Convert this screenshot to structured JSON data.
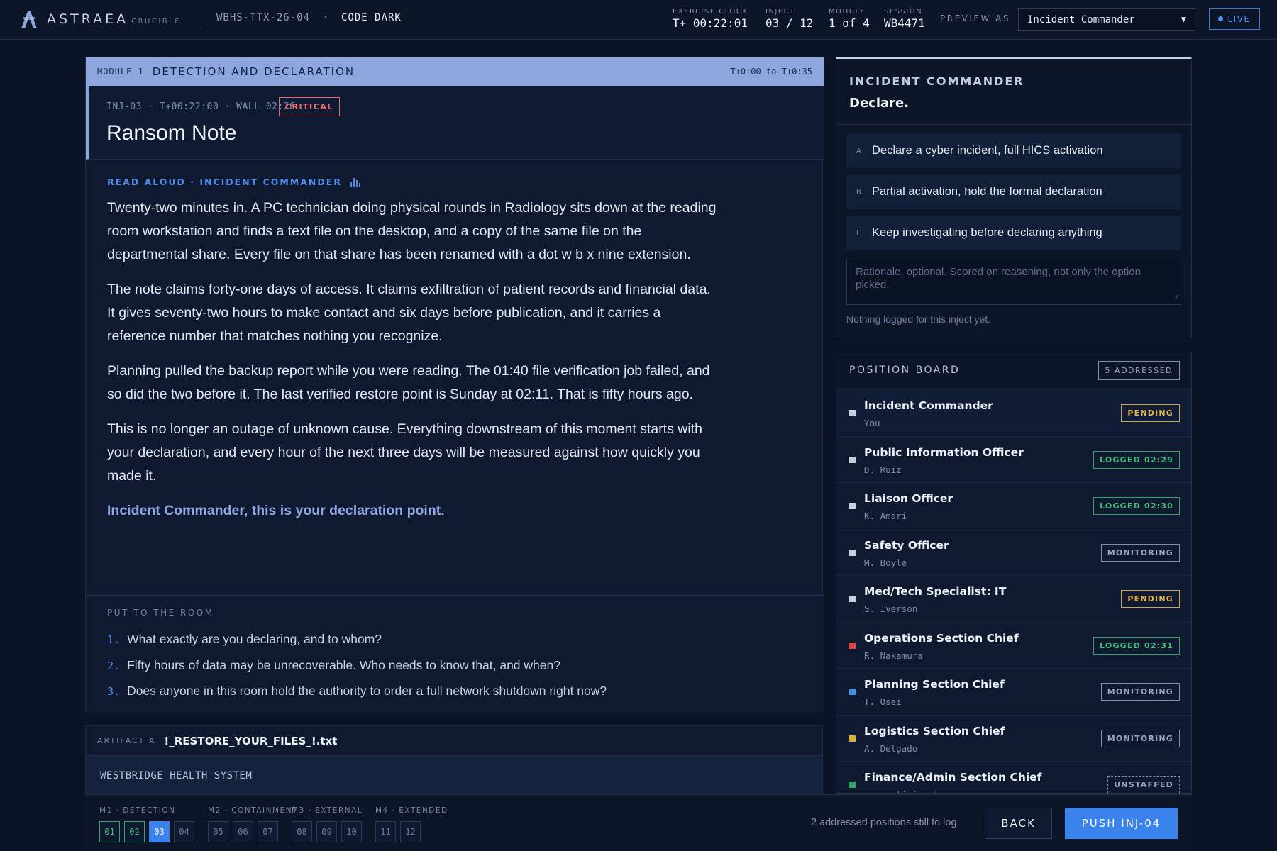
{
  "app": {
    "brand": "ASTRAEA",
    "brand_sub": "CRUCIBLE",
    "exercise_id": "WBHS-TTX-26-04",
    "separator": "·",
    "code": "CODE DARK"
  },
  "stats": {
    "clock_label": "EXERCISE CLOCK",
    "clock_value": "T+ 00:22:01",
    "inject_label": "INJECT",
    "inject_value": "03 / 12",
    "module_label": "MODULE",
    "module_value": "1 of 4",
    "session_label": "SESSION",
    "session_value": "WB4471"
  },
  "preview": {
    "label": "PREVIEW AS",
    "selected": "Incident Commander"
  },
  "live_label": "LIVE",
  "module": {
    "tag": "MODULE 1",
    "title": "DETECTION AND DECLARATION",
    "range": "T+0:00 to T+0:35"
  },
  "inject": {
    "meta": "INJ-03 · T+00:22:00 · WALL 02:26",
    "severity": "CRITICAL",
    "title": "Ransom Note",
    "read_aloud": "READ ALOUD · INCIDENT COMMANDER",
    "paragraphs": [
      "Twenty-two minutes in. A PC technician doing physical rounds in Radiology sits down at the reading room workstation and finds a text file on the desktop, and a copy of the same file on the departmental share. Every file on that share has been renamed with a dot w b x nine extension.",
      "The note claims forty-one days of access. It claims exfiltration of patient records and financial data. It gives seventy-two hours to make contact and six days before publication, and it carries a reference number that matches nothing you recognize.",
      "Planning pulled the backup report while you were reading. The 01:40 file verification job failed, and so did the two before it. The last verified restore point is Sunday at 02:11. That is fifty hours ago.",
      "This is no longer an outage of unknown cause. Everything downstream of this moment starts with your declaration, and every hour of the next three days will be measured against how quickly you made it."
    ],
    "callout": "Incident Commander, this is your declaration point."
  },
  "room": {
    "label": "PUT TO THE ROOM",
    "questions": [
      {
        "n": "1.",
        "text": "What exactly are you declaring, and to whom?"
      },
      {
        "n": "2.",
        "text": "Fifty hours of data may be unrecoverable. Who needs to know that, and when?"
      },
      {
        "n": "3.",
        "text": "Does anyone in this room hold the authority to order a full network shutdown right now?"
      }
    ]
  },
  "artifact": {
    "tag": "ARTIFACT A",
    "name": "!_RESTORE_YOUR_FILES_!.txt",
    "body": "WESTBRIDGE HEALTH SYSTEM"
  },
  "decision": {
    "role": "INCIDENT COMMANDER",
    "action": "Declare.",
    "options": [
      {
        "key": "A",
        "text": "Declare a cyber incident, full HICS activation"
      },
      {
        "key": "B",
        "text": "Partial activation, hold the formal declaration"
      },
      {
        "key": "C",
        "text": "Keep investigating before declaring anything"
      }
    ],
    "rationale_placeholder": "Rationale, optional. Scored on reasoning, not only the option picked.",
    "status": "Nothing logged for this inject yet."
  },
  "position_board": {
    "title": "POSITION BOARD",
    "badge": "5 ADDRESSED",
    "positions": [
      {
        "name": "Incident Commander",
        "person": "You",
        "status": "PENDING",
        "kind": "pending",
        "color": "#c8cfdc"
      },
      {
        "name": "Public Information Officer",
        "person": "D. Ruiz",
        "status": "LOGGED 02:29",
        "kind": "logged",
        "color": "#c8cfdc"
      },
      {
        "name": "Liaison Officer",
        "person": "K. Amari",
        "status": "LOGGED 02:30",
        "kind": "logged",
        "color": "#c8cfdc"
      },
      {
        "name": "Safety Officer",
        "person": "M. Boyle",
        "status": "MONITORING",
        "kind": "monitoring",
        "color": "#c8cfdc"
      },
      {
        "name": "Med/Tech Specialist: IT",
        "person": "S. Iverson",
        "status": "PENDING",
        "kind": "pending",
        "color": "#c8cfdc"
      },
      {
        "name": "Operations Section Chief",
        "person": "R. Nakamura",
        "status": "LOGGED 02:31",
        "kind": "logged",
        "color": "#e04848"
      },
      {
        "name": "Planning Section Chief",
        "person": "T. Osei",
        "status": "MONITORING",
        "kind": "monitoring",
        "color": "#3a8fe0"
      },
      {
        "name": "Logistics Section Chief",
        "person": "A. Delgado",
        "status": "MONITORING",
        "kind": "monitoring",
        "color": "#d8b02c"
      },
      {
        "name": "Finance/Admin Section Chief",
        "person": "no participant",
        "status": "UNSTAFFED",
        "kind": "unstaffed",
        "color": "#2fa566"
      }
    ]
  },
  "timeline": {
    "groups": [
      {
        "label": "M1 · DETECTION",
        "injects": [
          {
            "n": "01",
            "state": "done"
          },
          {
            "n": "02",
            "state": "done"
          },
          {
            "n": "03",
            "state": "current"
          },
          {
            "n": "04",
            "state": "todo"
          }
        ]
      },
      {
        "label": "M2 · CONTAINMENT",
        "injects": [
          {
            "n": "05",
            "state": "todo"
          },
          {
            "n": "06",
            "state": "todo"
          },
          {
            "n": "07",
            "state": "todo"
          }
        ]
      },
      {
        "label": "M3 · EXTERNAL",
        "injects": [
          {
            "n": "08",
            "state": "todo"
          },
          {
            "n": "09",
            "state": "todo"
          },
          {
            "n": "10",
            "state": "todo"
          }
        ]
      },
      {
        "label": "M4 · EXTENDED",
        "injects": [
          {
            "n": "11",
            "state": "todo"
          },
          {
            "n": "12",
            "state": "todo"
          }
        ]
      }
    ],
    "remaining": "2 addressed positions still to log.",
    "back_label": "BACK",
    "push_label": "PUSH INJ-04"
  }
}
